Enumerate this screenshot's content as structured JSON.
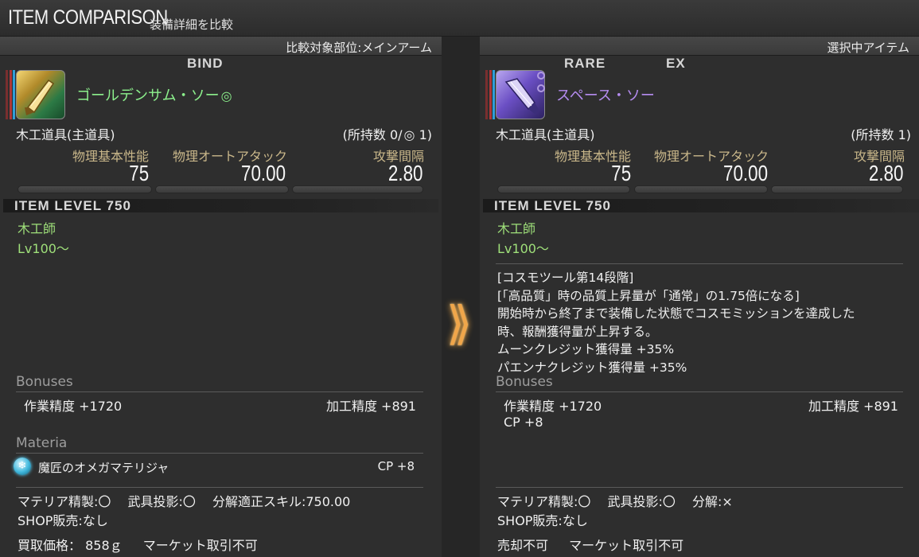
{
  "window": {
    "title": "ITEM COMPARISON",
    "subtitle": "装備詳細を比較"
  },
  "left": {
    "header": "比較対象部位:メインアーム",
    "tags": [
      "BIND"
    ],
    "icon": "golden-saw-icon",
    "name": "ゴールデンサム・ソー",
    "name_color": "#8cf08c",
    "category": "木工道具(主道具)",
    "owned": "(所持数 0/",
    "owned_hq_count": " 1)",
    "stats": [
      {
        "label": "物理基本性能",
        "value": "75"
      },
      {
        "label": "物理オートアタック",
        "value": "70.00"
      },
      {
        "label": "攻撃間隔",
        "value": "2.80"
      }
    ],
    "item_level": "ITEM LEVEL 750",
    "job": "木工師",
    "level": "Lv100〜",
    "bonuses_title": "Bonuses",
    "bonuses": [
      "作業精度 +1720",
      "加工精度 +891"
    ],
    "materia_title": "Materia",
    "materia": {
      "name": "魔匠のオメガマテリジャ",
      "effect": "CP +8",
      "icon": "snowflake-icon"
    },
    "footer": [
      "マテリア精製:〇　 武具投影:〇　 分解適正スキル:750.00",
      "SHOP販売:なし",
      "買取価格： 858ｇ　  マーケット取引不可"
    ]
  },
  "right": {
    "header": "選択中アイテム",
    "tags": [
      "RARE",
      "EX"
    ],
    "icon": "space-saw-icon",
    "name": "スペース・ソー",
    "name_color": "#b58cf0",
    "category": "木工道具(主道具)",
    "owned": "(所持数 1)",
    "stats": [
      {
        "label": "物理基本性能",
        "value": "75"
      },
      {
        "label": "物理オートアタック",
        "value": "70.00"
      },
      {
        "label": "攻撃間隔",
        "value": "2.80"
      }
    ],
    "item_level": "ITEM LEVEL 750",
    "job": "木工師",
    "level": "Lv100〜",
    "description": [
      "[コスモツール第14段階]",
      "[「高品質」時の品質上昇量が「通常」の1.75倍になる]",
      "開始時から終了まで装備した状態でコスモミッションを達成した",
      "時、報酬獲得量が上昇する。",
      "ムーンクレジット獲得量 +35%",
      "パエンナクレジット獲得量 +35%"
    ],
    "bonuses_title": "Bonuses",
    "bonuses": [
      "作業精度 +1720",
      "加工精度 +891",
      "CP +8"
    ],
    "footer": [
      "マテリア精製:〇　 武具投影:〇　 分解:×",
      "SHOP販売:なし",
      "売却不可　  マーケット取引不可"
    ]
  },
  "separator": {
    "arrow_icon": "double-chevron-right-icon"
  }
}
